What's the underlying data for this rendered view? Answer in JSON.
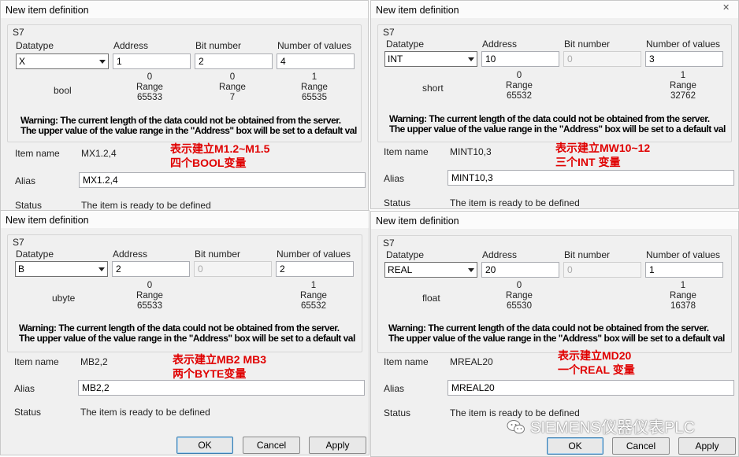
{
  "labels": {
    "group": "S7",
    "datatype": "Datatype",
    "address": "Address",
    "bit_number": "Bit number",
    "number_of_values": "Number of values",
    "range": "Range",
    "warning_line1": "Warning: The current length of the data could not be obtained from the server.",
    "warning_line2": "The upper value of the value range in the \"Address\" box will be set to a default val",
    "item_name": "Item name",
    "alias": "Alias",
    "status": "Status",
    "status_text": "The item is ready to be defined"
  },
  "buttons": {
    "ok": "OK",
    "cancel": "Cancel",
    "apply": "Apply"
  },
  "dialogs": [
    {
      "title": "New item definition",
      "datatype": "X",
      "address": "1",
      "bit_number": "2",
      "number_of_values": "4",
      "type_name": "bool",
      "addr_range": [
        "0",
        "65533"
      ],
      "bit_range": [
        "0",
        "7"
      ],
      "count_range": [
        "1",
        "65535"
      ],
      "item_name": "MX1.2,4",
      "alias": "MX1.2,4",
      "annotation1": "表示建立M1.2~M1.5",
      "annotation2": "四个BOOL变量"
    },
    {
      "title": "New item definition",
      "datatype": "INT",
      "address": "10",
      "bit_number": "0",
      "number_of_values": "3",
      "type_name": "short",
      "addr_range": [
        "0",
        "65532"
      ],
      "count_range": [
        "1",
        "32762"
      ],
      "item_name": "MINT10,3",
      "alias": "MINT10,3",
      "annotation1": "表示建立MW10~12",
      "annotation2": "三个INT 变量"
    },
    {
      "title": "New item definition",
      "datatype": "B",
      "address": "2",
      "bit_number": "0",
      "number_of_values": "2",
      "type_name": "ubyte",
      "addr_range": [
        "0",
        "65533"
      ],
      "count_range": [
        "1",
        "65532"
      ],
      "item_name": "MB2,2",
      "alias": "MB2,2",
      "annotation1": "表示建立MB2   MB3",
      "annotation2": "两个BYTE变量"
    },
    {
      "title": "New item definition",
      "datatype": "REAL",
      "address": "20",
      "bit_number": "0",
      "number_of_values": "1",
      "type_name": "float",
      "addr_range": [
        "0",
        "65530"
      ],
      "count_range": [
        "1",
        "16378"
      ],
      "item_name": "MREAL20",
      "alias": "MREAL20",
      "annotation1": "表示建立MD20",
      "annotation2": "一个REAL 变量"
    }
  ],
  "watermark": "SIEMENS仪器仪表PLC",
  "icons": {
    "close": "close-icon",
    "dropdown": "chevron-down-icon",
    "watermark": "wechat-icon"
  }
}
